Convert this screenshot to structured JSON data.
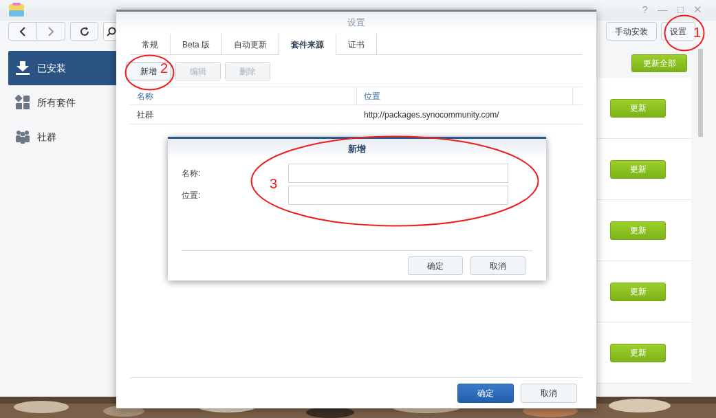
{
  "window": {
    "controls": [
      "?",
      "—",
      "□",
      "✕"
    ]
  },
  "toolbar": {
    "buttons": [
      "手动安装",
      "设置"
    ]
  },
  "sidebar": {
    "items": [
      {
        "label": "已安装",
        "selected": true
      },
      {
        "label": "所有套件",
        "selected": false
      },
      {
        "label": "社群",
        "selected": false
      }
    ]
  },
  "content": {
    "update_all": "更新全部",
    "rows": [
      {
        "button": "更新"
      },
      {
        "button": "更新"
      },
      {
        "button": "更新"
      },
      {
        "button": "更新"
      },
      {
        "button": "更新"
      }
    ]
  },
  "settings_dialog": {
    "title": "设置",
    "tabs": [
      {
        "label": "常规",
        "selected": false
      },
      {
        "label": "Beta 版",
        "selected": false
      },
      {
        "label": "自动更新",
        "selected": false
      },
      {
        "label": "套件来源",
        "selected": true
      },
      {
        "label": "证书",
        "selected": false
      }
    ],
    "actions": [
      {
        "label": "新增",
        "disabled": false
      },
      {
        "label": "编辑",
        "disabled": true
      },
      {
        "label": "删除",
        "disabled": true
      }
    ],
    "table": {
      "columns": [
        "名称",
        "位置"
      ],
      "rows": [
        [
          "社群",
          "http://packages.synocommunity.com/"
        ]
      ]
    },
    "buttons": [
      {
        "label": "确定",
        "kind": "primary"
      },
      {
        "label": "取消",
        "kind": "secondary"
      }
    ]
  },
  "add_dialog": {
    "title": "新增",
    "fields": [
      {
        "label": "名称:"
      },
      {
        "label": "位置:"
      }
    ],
    "buttons": [
      {
        "label": "确定"
      },
      {
        "label": "取消"
      }
    ]
  },
  "annotations": [
    {
      "label": "1"
    },
    {
      "label": "2"
    },
    {
      "label": "3"
    }
  ]
}
